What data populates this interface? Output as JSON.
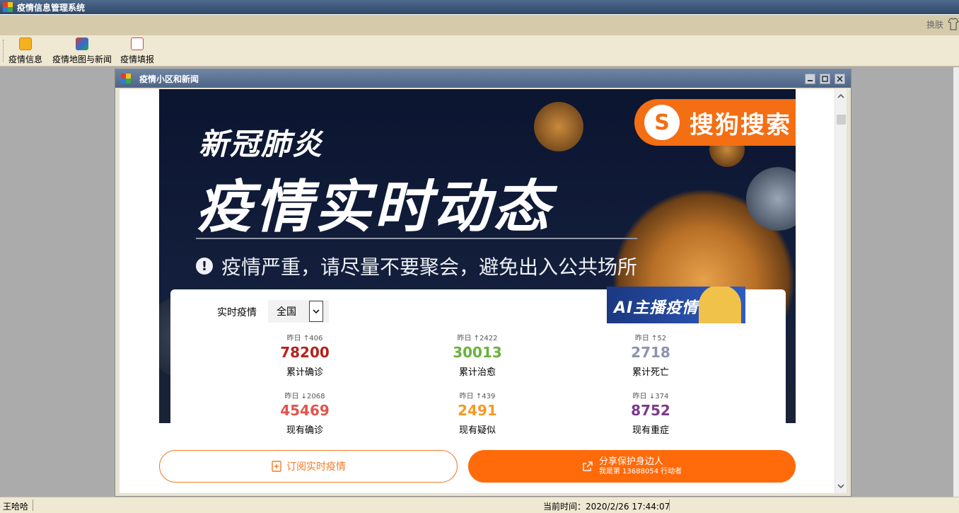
{
  "window": {
    "title": "疫情信息管理系统"
  },
  "skin": {
    "label": "换肤"
  },
  "toolbar": {
    "items": [
      {
        "label": "疫情信息",
        "icon": "document-icon"
      },
      {
        "label": "疫情地图与新闻",
        "icon": "map-news-icon"
      },
      {
        "label": "疫情填报",
        "icon": "edit-form-icon"
      }
    ]
  },
  "child": {
    "title": "疫情小区和新闻"
  },
  "banner": {
    "brand": "搜狗搜索",
    "subtitle": "新冠肺炎",
    "title": "疫情实时动态",
    "warning": "疫情严重，请尽量不要聚会，避免出入公共场所",
    "ai_label": "AI主播疫情播报"
  },
  "realtime": {
    "label": "实时疫情",
    "region": "全国",
    "stats": [
      {
        "delta": "昨日 ↑406",
        "value": "78200",
        "label": "累计确诊",
        "color": "#b3221b"
      },
      {
        "delta": "昨日 ↑2422",
        "value": "30013",
        "label": "累计治愈",
        "color": "#67b33a"
      },
      {
        "delta": "昨日 ↑52",
        "value": "2718",
        "label": "累计死亡",
        "color": "#8c93ad"
      },
      {
        "delta": "昨日 ↓2068",
        "value": "45469",
        "label": "现有确诊",
        "color": "#e0554e"
      },
      {
        "delta": "昨日 ↑439",
        "value": "2491",
        "label": "现有疑似",
        "color": "#f39a25"
      },
      {
        "delta": "昨日 ↓374",
        "value": "8752",
        "label": "现有重症",
        "color": "#7b3a8c"
      }
    ]
  },
  "actions": {
    "subscribe": "订阅实时疫情",
    "share_title": "分享保护身边人",
    "share_sub": "我是第 13688054 行动者"
  },
  "statusbar": {
    "user": "王哈哈",
    "time": "当前时间：2020/2/26 17:44:07"
  }
}
